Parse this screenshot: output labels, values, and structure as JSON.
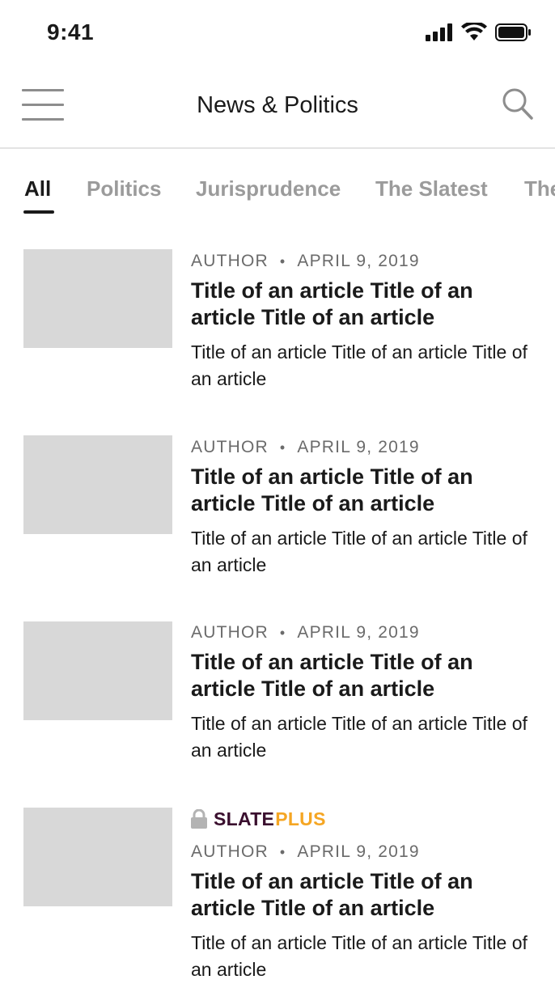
{
  "status_bar": {
    "time": "9:41"
  },
  "nav": {
    "title": "News & Politics"
  },
  "tabs": [
    {
      "label": "All",
      "active": true
    },
    {
      "label": "Politics",
      "active": false
    },
    {
      "label": "Jurisprudence",
      "active": false
    },
    {
      "label": "The Slatest",
      "active": false
    },
    {
      "label": "The",
      "active": false
    }
  ],
  "articles": [
    {
      "author": "AUTHOR",
      "separator": "•",
      "date": "APRIL 9, 2019",
      "title": "Title of an article Title of an article Title of an article",
      "dek": "Title of an article Title of an article Title of an article"
    },
    {
      "author": "AUTHOR",
      "separator": "•",
      "date": "APRIL 9, 2019",
      "title": "Title of an article Title of an article Title of an article",
      "dek": "Title of an article Title of an article Title of an article"
    },
    {
      "author": "AUTHOR",
      "separator": "•",
      "date": "APRIL 9, 2019",
      "title": "Title of an article Title of an article Title of an article",
      "dek": "Title of an article Title of an article Title of an article"
    },
    {
      "badge": {
        "icon": "lock-icon",
        "brand": "SLATE",
        "plus": "PLUS"
      },
      "author": "AUTHOR",
      "separator": "•",
      "date": "APRIL 9, 2019",
      "title": "Title of an article Title of an article Title of an article",
      "dek": "Title of an article Title of an article Title of an article"
    }
  ],
  "colors": {
    "accent_text": "#1a1a1a",
    "inactive_tab": "#9b9b9b",
    "placeholder": "#d8d8d8",
    "plus_brand": "#3a0f2e",
    "plus_gold": "#f5a623"
  }
}
